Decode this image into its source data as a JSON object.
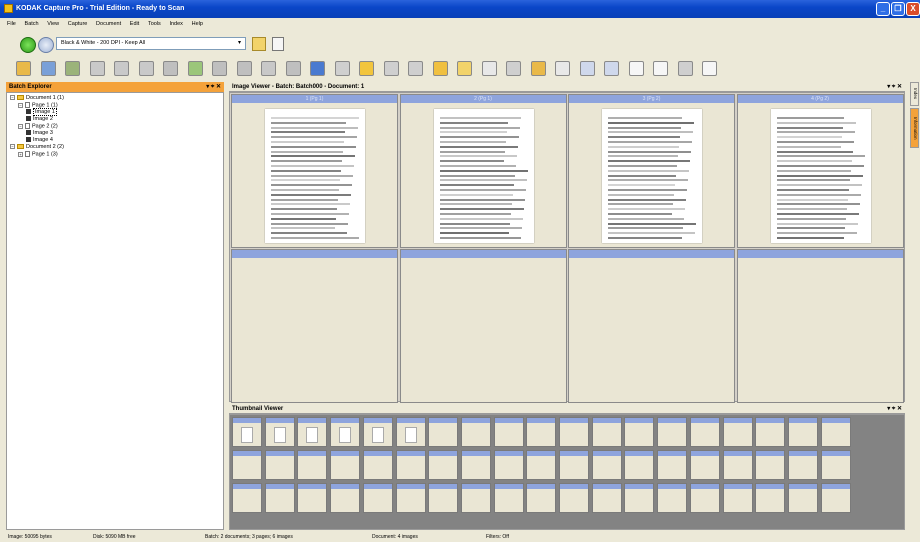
{
  "window": {
    "title": "KODAK Capture Pro - Trial Edition - Ready to Scan",
    "minimize": "_",
    "maximize": "❐",
    "close": "X"
  },
  "menu": [
    "File",
    "Batch",
    "View",
    "Capture",
    "Document",
    "Edit",
    "Tools",
    "Index",
    "Help"
  ],
  "job_setup": "Black & White - 200 DPI - Keep All",
  "batch_explorer": {
    "title": "Batch Explorer",
    "pin": "▾ ⌖ ✕",
    "tree": [
      {
        "label": "Document 1 (1)",
        "level": 0,
        "kind": "folder",
        "toggle": "−"
      },
      {
        "label": "Page 1 (1)",
        "level": 1,
        "kind": "page",
        "toggle": "−"
      },
      {
        "label": "Image 1",
        "level": 2,
        "kind": "image",
        "toggle": ""
      },
      {
        "label": "Image 2",
        "level": 2,
        "kind": "image",
        "toggle": ""
      },
      {
        "label": "Page 2 (2)",
        "level": 1,
        "kind": "page",
        "toggle": "−"
      },
      {
        "label": "Image 3",
        "level": 2,
        "kind": "image",
        "toggle": ""
      },
      {
        "label": "Image 4",
        "level": 2,
        "kind": "image",
        "toggle": ""
      },
      {
        "label": "Document 2 (2)",
        "level": 0,
        "kind": "folder",
        "toggle": "−"
      },
      {
        "label": "Page 1 (3)",
        "level": 1,
        "kind": "page",
        "toggle": "+"
      }
    ]
  },
  "image_viewer": {
    "title": "Image Viewer - Batch: Batch000 - Document: 1",
    "pin": "▾ ⌖ ✕",
    "cells": [
      {
        "caption": "1 (Pg 1)",
        "has_image": true
      },
      {
        "caption": "2 (Pg 1)",
        "has_image": true
      },
      {
        "caption": "3 (Pg 2)",
        "has_image": true
      },
      {
        "caption": "4 (Pg 2)",
        "has_image": true
      },
      {
        "caption": "",
        "has_image": false
      },
      {
        "caption": "",
        "has_image": false
      },
      {
        "caption": "",
        "has_image": false
      },
      {
        "caption": "",
        "has_image": false
      }
    ]
  },
  "thumbnail_viewer": {
    "title": "Thumbnail Viewer",
    "pin": "▾ ⌖ ✕",
    "rows": 3,
    "cols": 19,
    "filled": 6
  },
  "side_tabs": [
    "Index",
    "Information"
  ],
  "status": {
    "image": "Image: 50095 bytes",
    "disk": "Disk: 5090 MB free",
    "batch": "Batch: 2 documents; 3 pages; 6 images",
    "document": "Document: 4 images",
    "filters": "Filters: Off"
  },
  "colors": {
    "title_blue": "#0a46c8",
    "panel_header_orange": "#f4a23a",
    "caption_blue": "#8ea4dd",
    "cell_bg": "#eae6d4"
  },
  "toolbar_icons": [
    "scan-folder-icon",
    "batch-icon",
    "flag-icon",
    "blank-icon",
    "rotate-left-icon",
    "rotate-right-icon",
    "copy-icon",
    "crop-icon",
    "paste-icon",
    "split-icon",
    "merge-icon",
    "grid-icon",
    "undo-icon",
    "zoom-tool-icon",
    "folder-icon",
    "arrow-icon",
    "arrow2-icon",
    "pencil-icon",
    "pointer-icon",
    "page-dropdown-icon",
    "zoom-area-icon",
    "pan-icon",
    "layout-icon",
    "zoom-in-icon",
    "zoom-out-icon",
    "checkbox-icon",
    "document-icon",
    "hand-icon",
    "info-icon"
  ]
}
